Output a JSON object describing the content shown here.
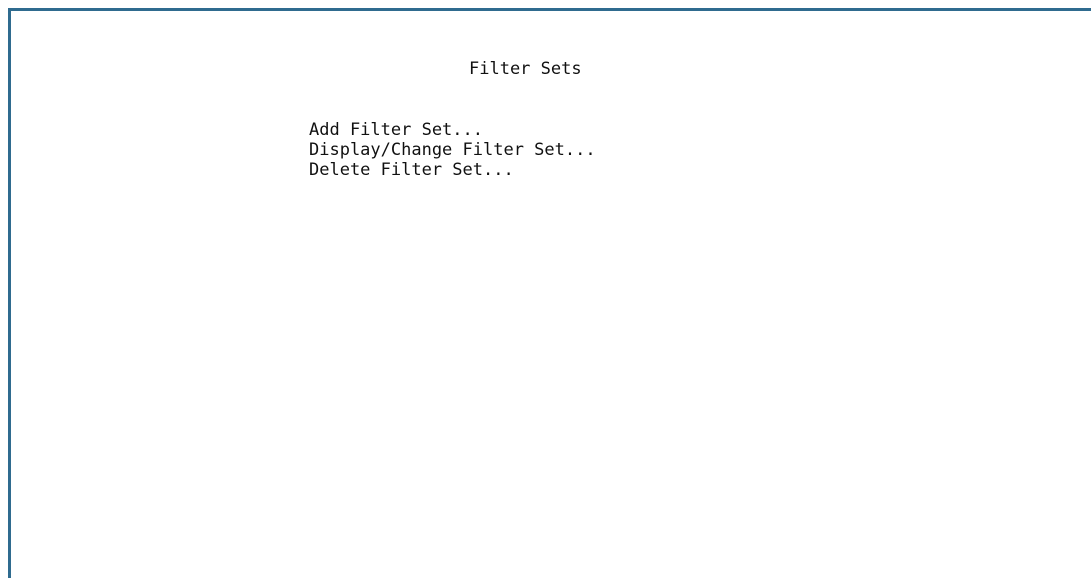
{
  "screen": {
    "title": "Filter Sets",
    "border_color": "#2f6b8f"
  },
  "menu": {
    "items": [
      {
        "label": "Add Filter Set..."
      },
      {
        "label": "Display/Change Filter Set..."
      },
      {
        "label": "Delete Filter Set..."
      }
    ]
  }
}
